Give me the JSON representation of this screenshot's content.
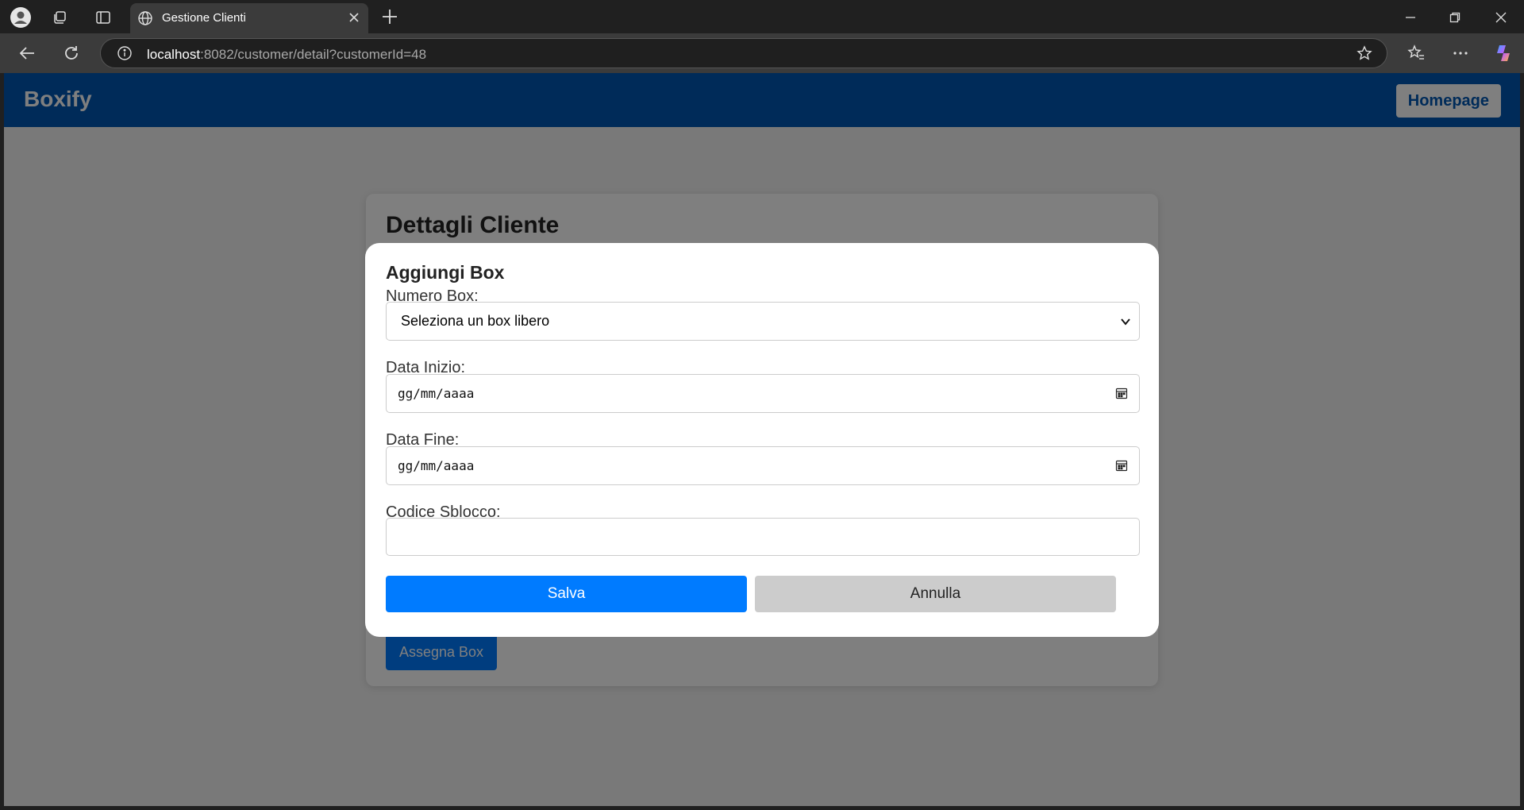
{
  "browser": {
    "tab_title": "Gestione Clienti",
    "url_host": "localhost",
    "url_rest": ":8082/customer/detail?customerId=48"
  },
  "app": {
    "brand": "Boxify",
    "home_button": "Homepage"
  },
  "page": {
    "title": "Dettagli Cliente",
    "assign_button": "Assegna Box"
  },
  "modal": {
    "title": "Aggiungi Box",
    "box_number_label": "Numero Box:",
    "box_number_selected": "Seleziona un box libero",
    "start_date_label": "Data Inizio:",
    "start_date_placeholder": "gg/mm/aaaa",
    "end_date_label": "Data Fine:",
    "end_date_placeholder": "gg/mm/aaaa",
    "unlock_code_label": "Codice Sblocco:",
    "unlock_code_value": "",
    "save_button": "Salva",
    "cancel_button": "Annulla"
  },
  "colors": {
    "header": "#0056b3",
    "primary": "#007bff",
    "cancel": "#cccccc"
  }
}
